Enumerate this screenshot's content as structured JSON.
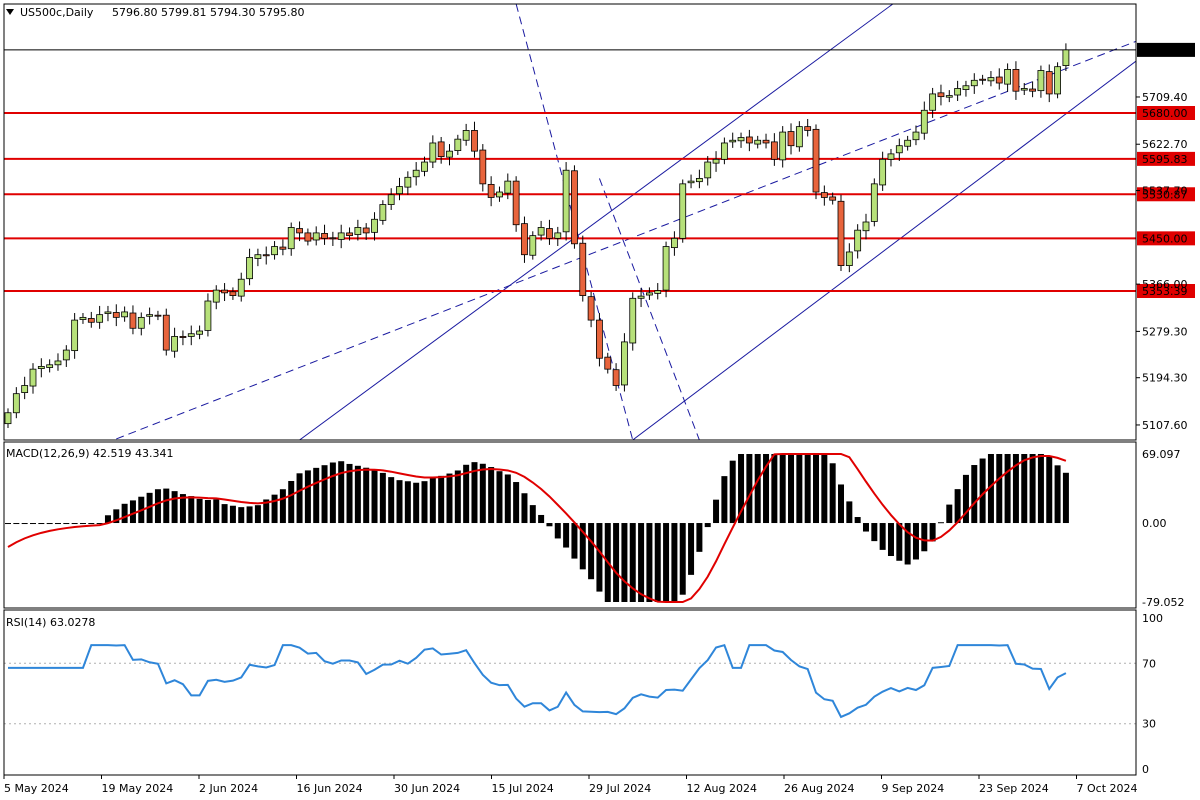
{
  "colors": {
    "bull": "#b7e17a",
    "bear": "#e8643c",
    "wick": "#000000",
    "level_line": "#e00000",
    "level_box": "#e00000",
    "trend_line": "#1a1aa0",
    "macd_hist": "#000000",
    "macd_signal": "#e00000",
    "rsi_line": "#2f86d9",
    "grid_dots": "#b0b0b0",
    "frame": "#000000"
  },
  "chart_data": [
    {
      "type": "candlestick",
      "title": "US500c,Daily",
      "ohlc_label": "5796.80 5799.81 5794.30 5795.80",
      "current_price": "5795.80",
      "y_ticks": [
        "5709.40",
        "5622.70",
        "5537.70",
        "5366.00",
        "5279.30",
        "5194.30",
        "5107.60"
      ],
      "ylim": [
        5080,
        5880
      ],
      "levels": [
        "5680.00",
        "5595.83",
        "5530.87",
        "5450.00",
        "5353.39"
      ],
      "x_tick_labels": [
        "5 May 2024",
        "19 May 2024",
        "2 Jun 2024",
        "16 Jun 2024",
        "30 Jun 2024",
        "15 Jul 2024",
        "29 Jul 2024",
        "12 Aug 2024",
        "26 Aug 2024",
        "9 Sep 2024",
        "23 Sep 2024",
        "7 Oct 2024"
      ],
      "closes": [
        5130,
        5165,
        5180,
        5210,
        5215,
        5218,
        5225,
        5245,
        5300,
        5305,
        5296,
        5310,
        5315,
        5305,
        5315,
        5285,
        5305,
        5310,
        5308,
        5245,
        5270,
        5268,
        5275,
        5280,
        5335,
        5355,
        5350,
        5345,
        5375,
        5415,
        5420,
        5418,
        5435,
        5430,
        5470,
        5460,
        5445,
        5460,
        5450,
        5450,
        5460,
        5455,
        5470,
        5460,
        5485,
        5512,
        5530,
        5545,
        5562,
        5575,
        5590,
        5625,
        5600,
        5610,
        5632,
        5648,
        5610,
        5550,
        5525,
        5535,
        5555,
        5475,
        5420,
        5455,
        5470,
        5450,
        5460,
        5575,
        5440,
        5345,
        5300,
        5230,
        5210,
        5180,
        5260,
        5340,
        5344,
        5350,
        5354,
        5435,
        5450,
        5550,
        5555,
        5560,
        5590,
        5595,
        5625,
        5630,
        5635,
        5625,
        5630,
        5625,
        5595,
        5645,
        5620,
        5655,
        5648,
        5535,
        5525,
        5520,
        5400,
        5425,
        5465,
        5480,
        5550,
        5595,
        5605,
        5620,
        5630,
        5645,
        5685,
        5715,
        5710,
        5712,
        5725,
        5730,
        5740,
        5740,
        5745,
        5735,
        5760,
        5720,
        5725,
        5720,
        5758,
        5715,
        5765,
        5795.8
      ],
      "macd": {
        "label": "MACD(12,26,9) 42.519 43.341",
        "y_ticks": [
          "69.097",
          "0.00",
          "-79.052"
        ],
        "ylim": [
          -79.052,
          69.097
        ]
      },
      "rsi": {
        "label": "RSI(14) 63.0278",
        "y_ticks": [
          "100",
          "70",
          "30",
          "0"
        ],
        "ylim": [
          0,
          100
        ]
      }
    }
  ]
}
